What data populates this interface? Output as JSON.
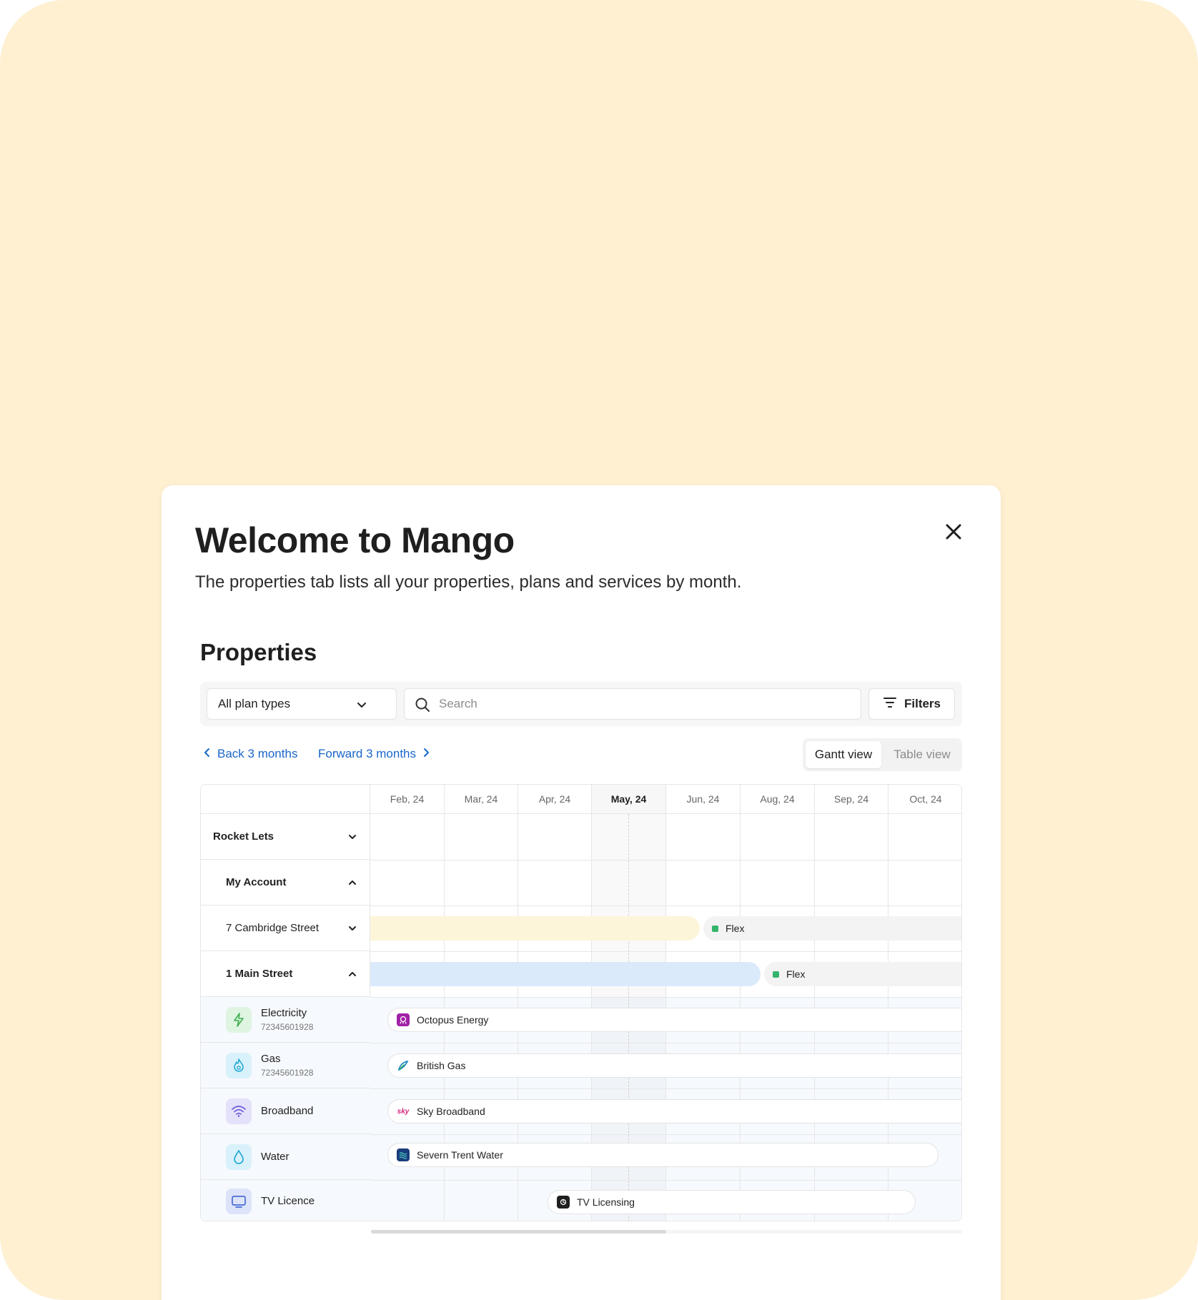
{
  "modal": {
    "title": "Welcome to Mango",
    "subtitle": "The properties tab lists all your properties, plans and services by month.",
    "close_icon": "close-icon"
  },
  "properties": {
    "title": "Properties",
    "plan_select": {
      "value": "All plan types",
      "icon": "chevron-down-icon"
    },
    "search": {
      "placeholder": "Search",
      "icon": "search-icon"
    },
    "filters": {
      "label": "Filters",
      "icon": "filter-icon"
    },
    "nav": {
      "back_label": "Back 3 months",
      "forward_label": "Forward 3 months"
    },
    "views": {
      "active": "Gantt view",
      "inactive": "Table view"
    }
  },
  "gantt": {
    "months": [
      "Feb, 24",
      "Mar, 24",
      "Apr, 24",
      "May, 24",
      "Jun, 24",
      "Aug, 24",
      "Sep, 24",
      "Oct, 24"
    ],
    "current_month": "May, 24",
    "rows": [
      {
        "label": "Rocket Lets",
        "expanded": false
      },
      {
        "label": "My Account",
        "expanded": true
      },
      {
        "label": "7 Cambridge Street",
        "expanded": false,
        "plan_label": "Flex",
        "bar_color": "#fdf5d9"
      },
      {
        "label": "1 Main Street",
        "expanded": true,
        "plan_label": "Flex",
        "bar_color": "#dbeafb"
      }
    ],
    "services": [
      {
        "name": "Electricity",
        "meter": "72345601928",
        "icon": "lightning-icon",
        "provider": "Octopus Energy",
        "icon_color": "#3fae4d",
        "icon_bg": "#dff5e2",
        "logo_color": "#a021a6"
      },
      {
        "name": "Gas",
        "meter": "72345601928",
        "icon": "flame-icon",
        "provider": "British Gas",
        "icon_color": "#25a9d6",
        "icon_bg": "#d9f1fa",
        "logo_color": "#0a7fc2"
      },
      {
        "name": "Broadband",
        "icon": "wifi-icon",
        "provider": "Sky Broadband",
        "icon_color": "#6c5bd9",
        "icon_bg": "#e4e1fa",
        "logo_text": "sky"
      },
      {
        "name": "Water",
        "icon": "water-drop-icon",
        "provider": "Severn Trent Water",
        "icon_color": "#25a9d6",
        "icon_bg": "#d9f1fa",
        "logo_color": "#1a3d7c"
      },
      {
        "name": "TV Licence",
        "icon": "tv-icon",
        "provider": "TV Licensing",
        "icon_color": "#4a6cd4",
        "icon_bg": "#dde4fa",
        "logo_color": "#1f1f1f"
      }
    ]
  }
}
